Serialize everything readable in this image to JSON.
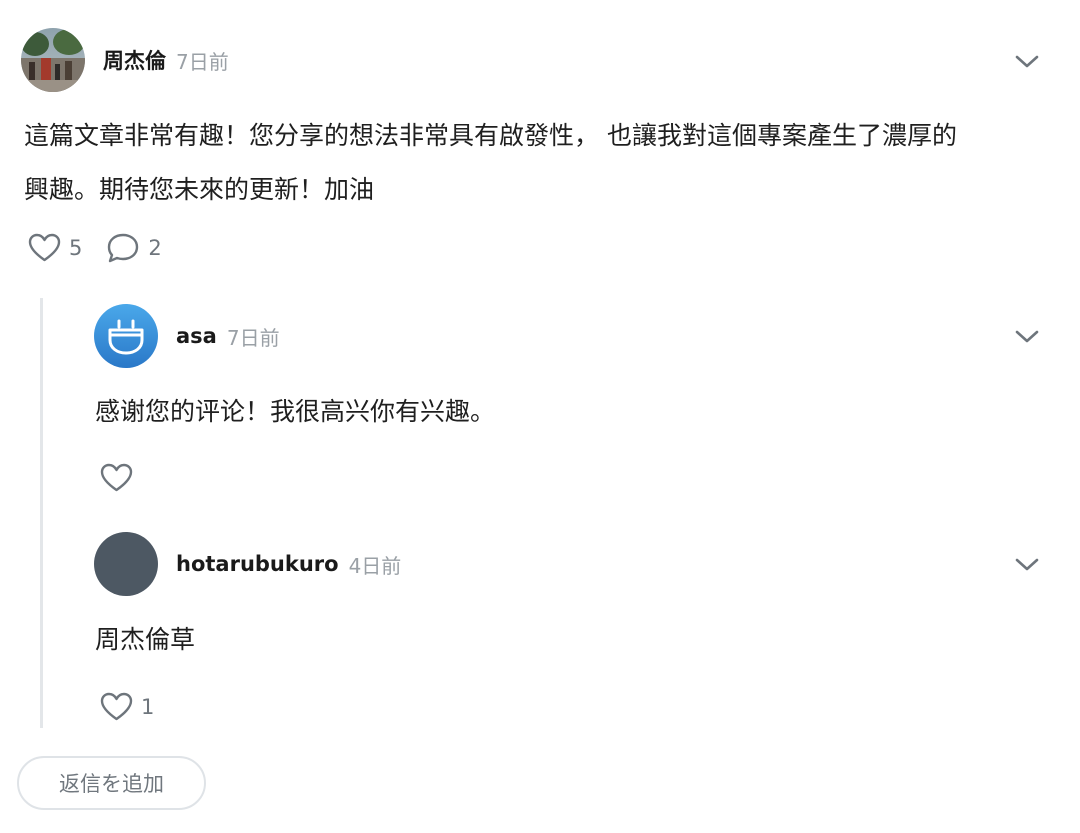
{
  "comment": {
    "author": "周杰倫",
    "time": "7日前",
    "body_lines": [
      "這篇文章非常有趣！您分享的想法非常具有啟發性， 也讓我對這個專案產生了濃厚的",
      "興趣。期待您未來的更新！加油"
    ],
    "likes": "5",
    "replies_count": "2"
  },
  "replies": [
    {
      "author": "asa",
      "time": "7日前",
      "body": "感谢您的评论！我很高兴你有兴趣。",
      "likes": ""
    },
    {
      "author": "hotarubukuro",
      "time": "4日前",
      "body": "周杰倫草",
      "likes": "1"
    }
  ],
  "reply_button": "返信を追加",
  "colors": {
    "muted": "#9aa0a6",
    "icon": "#6e757c",
    "thread_line": "#e3e6e9",
    "avatar_asa_top": "#4aa8ea",
    "avatar_asa_bottom": "#2a78c8",
    "avatar_hotaru": "#4d5863"
  },
  "icons": [
    "heart-icon",
    "comment-bubble-icon",
    "chevron-down-icon",
    "plug-icon"
  ]
}
